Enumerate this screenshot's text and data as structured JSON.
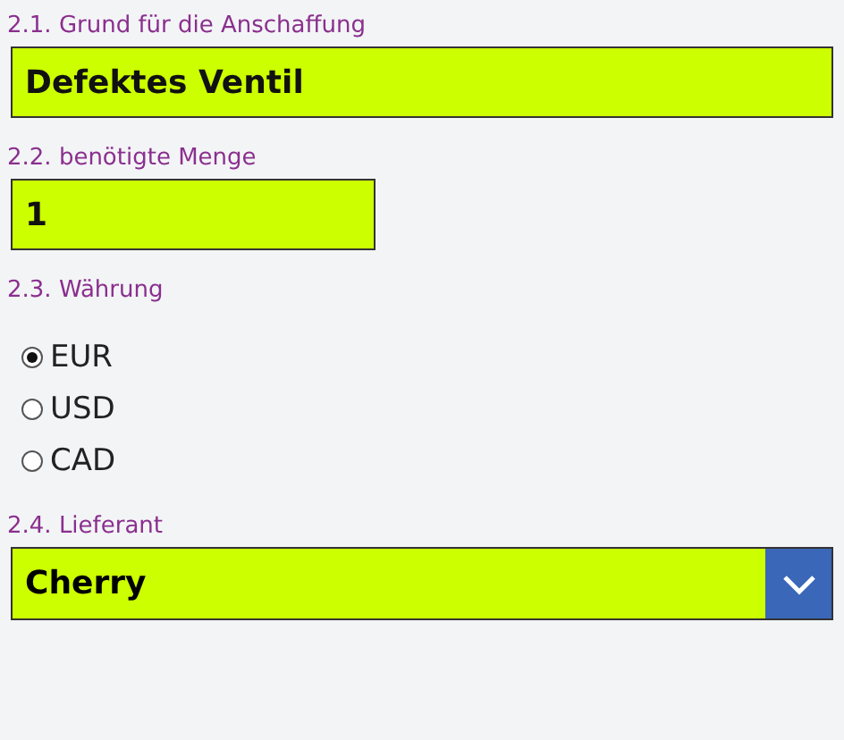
{
  "fields": [
    {
      "kind": "text",
      "label": "2.1. Grund für die Anschaffung",
      "value": "Defektes Ventil"
    },
    {
      "kind": "number",
      "label": "2.2. benötigte Menge",
      "value": "1"
    },
    {
      "kind": "radio",
      "label": "2.3. Währung",
      "options": [
        {
          "label": "EUR",
          "selected": true
        },
        {
          "label": "USD",
          "selected": false
        },
        {
          "label": "CAD",
          "selected": false
        }
      ]
    },
    {
      "kind": "select",
      "label": "2.4. Lieferant",
      "value": "Cherry"
    }
  ]
}
